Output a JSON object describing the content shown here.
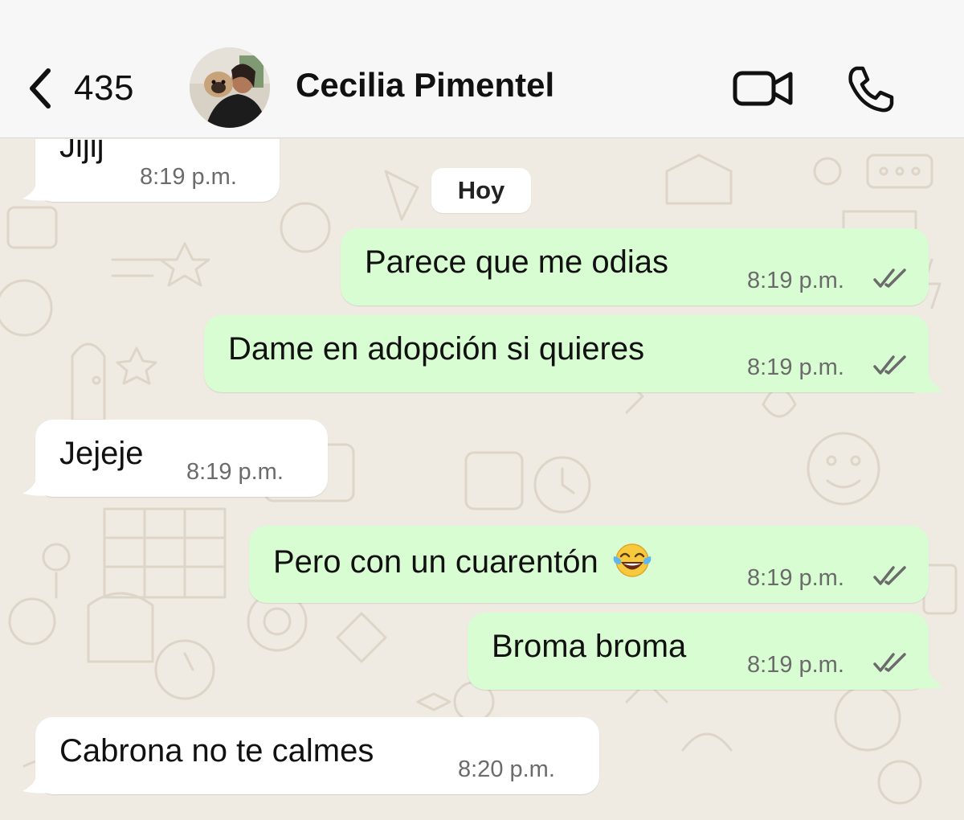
{
  "header": {
    "back_count": "435",
    "contact_name": "Cecilia Pimentel"
  },
  "chat": {
    "day_label": "Hoy",
    "messages": [
      {
        "direction": "in",
        "text": "Jijij",
        "time": "8:19 p.m."
      },
      {
        "direction": "out",
        "text": "Parece que me odias",
        "time": "8:19 p.m.",
        "status": "read"
      },
      {
        "direction": "out",
        "text": "Dame en adopción si quieres",
        "time": "8:19 p.m.",
        "status": "read"
      },
      {
        "direction": "in",
        "text": "Jejeje",
        "time": "8:19 p.m."
      },
      {
        "direction": "out",
        "text": "Pero con un cuarentón",
        "emoji": "face-with-tears-of-joy",
        "time": "8:19 p.m.",
        "status": "read"
      },
      {
        "direction": "out",
        "text": "Broma broma",
        "time": "8:19 p.m.",
        "status": "read"
      },
      {
        "direction": "in",
        "text": "Cabrona no te calmes",
        "time": "8:20 p.m."
      }
    ]
  },
  "colors": {
    "incoming_bubble": "#ffffff",
    "outgoing_bubble": "#d9fdd3",
    "chat_background": "#efeae2",
    "header_background": "#f7f7f7",
    "read_ticks": "#6b6b6b"
  },
  "icons": {
    "back": "chevron-left-icon",
    "video": "video-camera-icon",
    "call": "phone-icon",
    "ticks": "double-check-icon"
  }
}
